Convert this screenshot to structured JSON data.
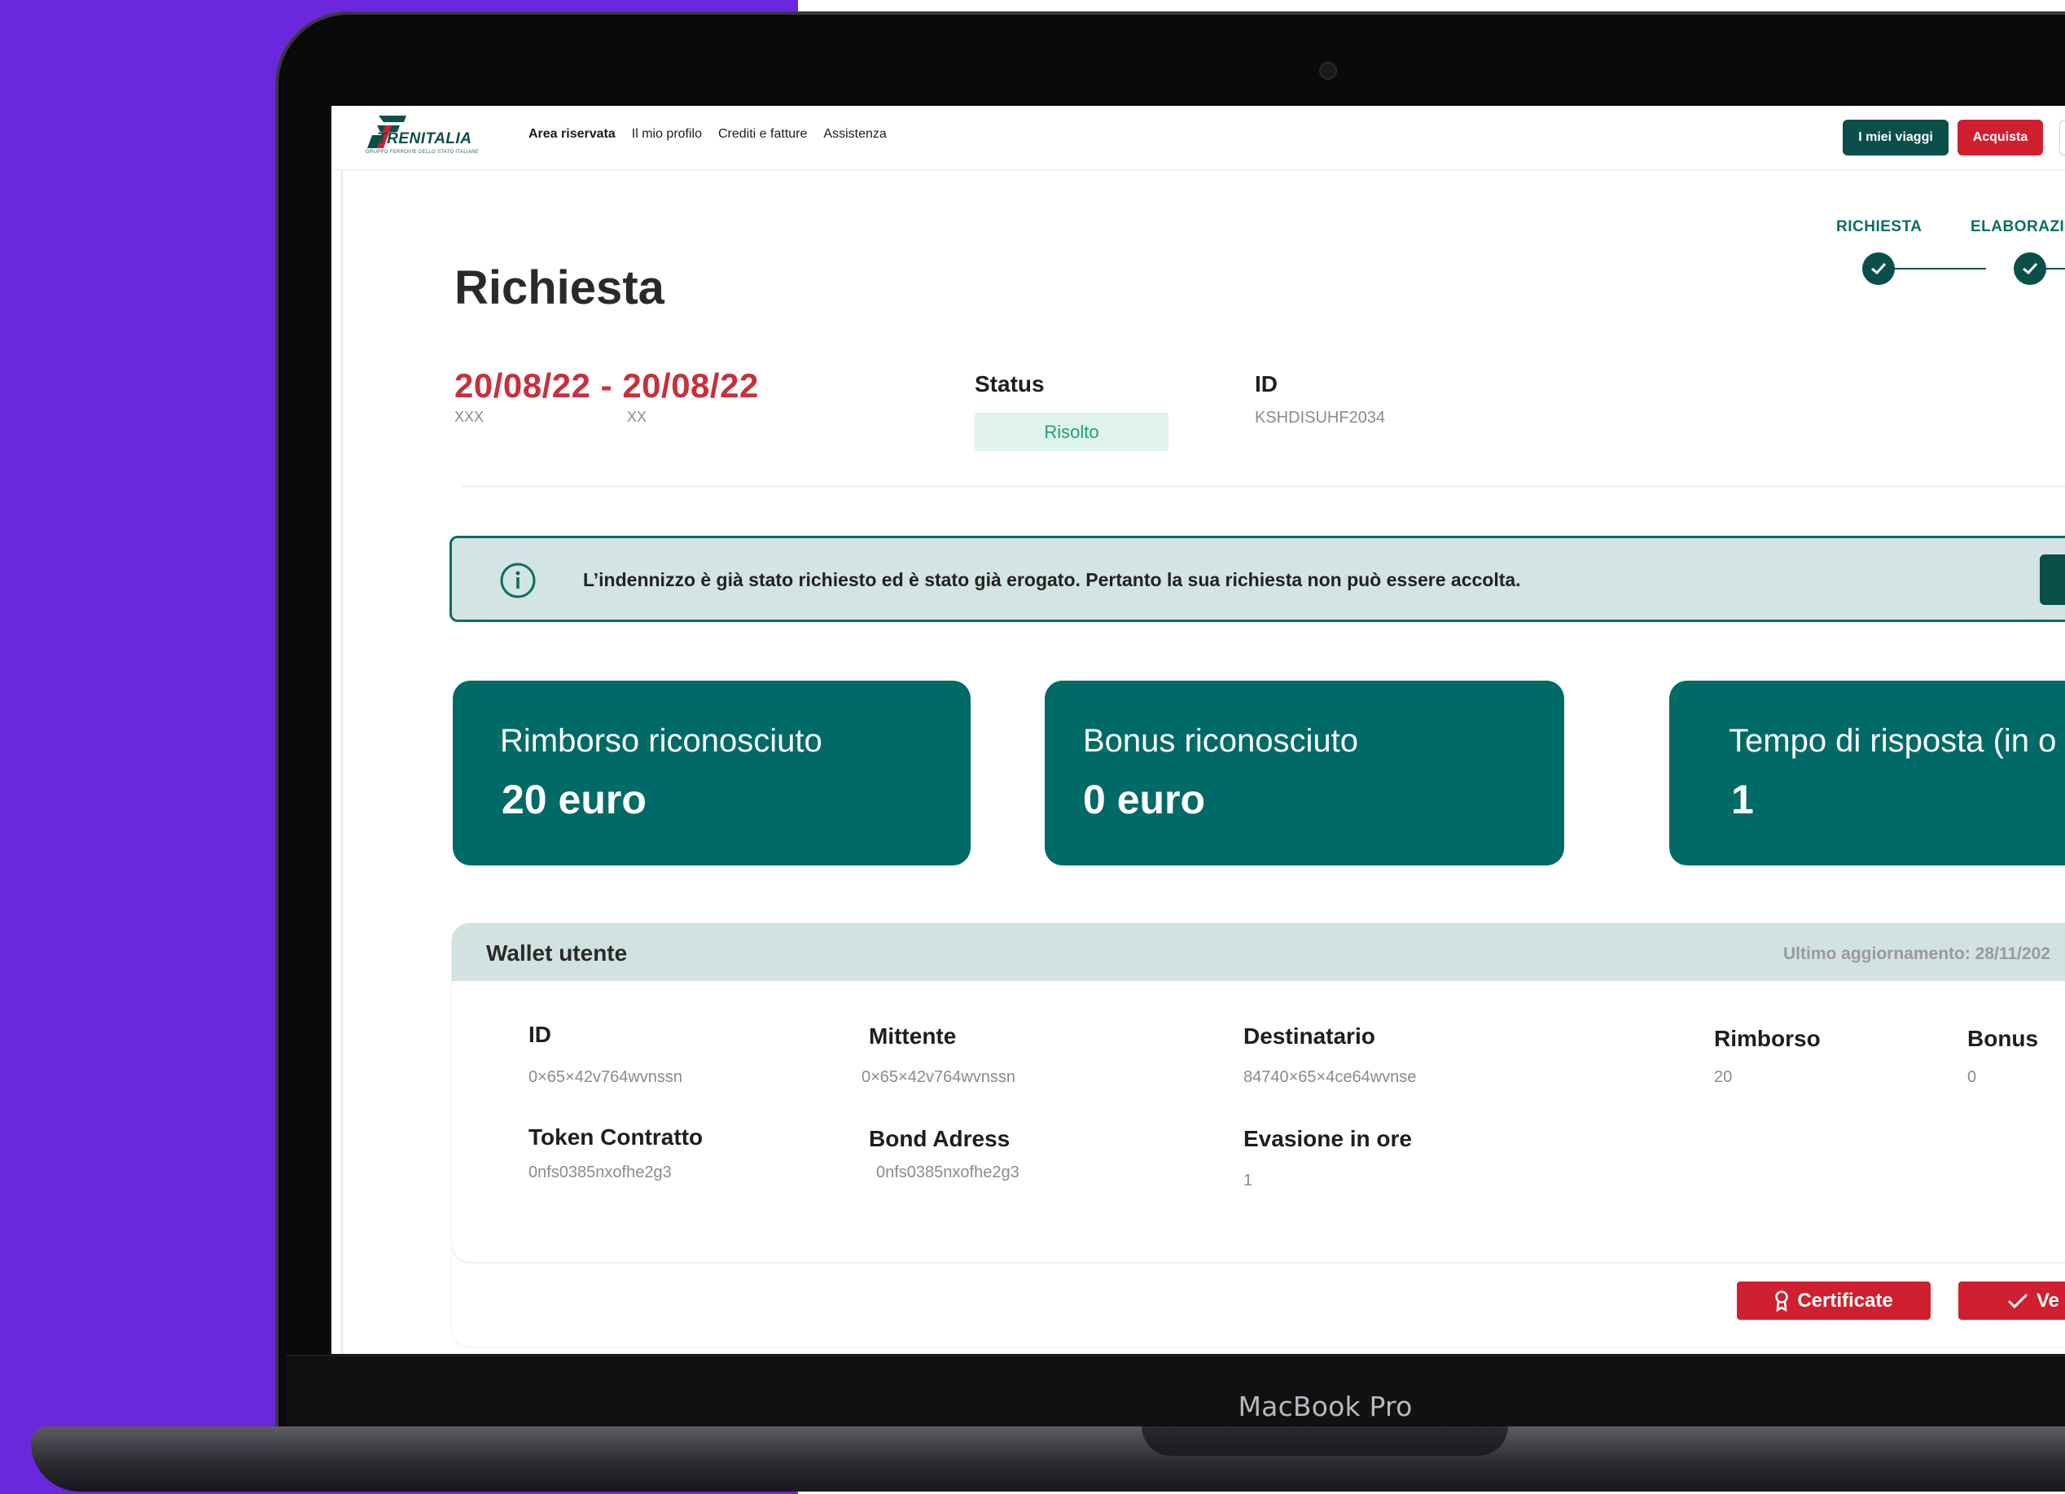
{
  "header": {
    "logo_text": "TRENITALIA",
    "logo_sub": "GRUPPO FERROVIE DELLO STATO ITALIANE",
    "nav": [
      "Area riservata",
      "Il mio profilo",
      "Crediti e fatture",
      "Assistenza"
    ],
    "btn_viaggi": "I miei viaggi",
    "btn_acquista": "Acquista"
  },
  "stepper": {
    "steps": [
      "RICHIESTA",
      "ELABORAZI"
    ]
  },
  "request": {
    "title": "Richiesta",
    "dates": "20/08/22 - 20/08/22",
    "sub_a": "XXX",
    "sub_b": "XX",
    "status_label": "Status",
    "status_value": "Risolto",
    "id_label": "ID",
    "id_value": "KSHDISUHF2034"
  },
  "banner": {
    "text": "L’indennizzo è già stato richiesto ed è stato già erogato. Pertanto la sua richiesta non può essere accolta."
  },
  "cards": [
    {
      "title": "Rimborso riconosciuto",
      "value": "20 euro"
    },
    {
      "title": "Bonus riconosciuto",
      "value": "0 euro"
    },
    {
      "title": "Tempo di risposta (in o",
      "value": "1"
    }
  ],
  "wallet": {
    "title": "Wallet utente",
    "updated": "Ultimo aggiornamento: 28/11/202",
    "fields": [
      {
        "label": "ID",
        "value": "0×65×42v764wvnssn"
      },
      {
        "label": "Mittente",
        "value": "0×65×42v764wvnssn"
      },
      {
        "label": "Destinatario",
        "value": "84740×65×4ce64wvnse"
      },
      {
        "label": "Rimborso",
        "value": "20"
      },
      {
        "label": "Bonus",
        "value": "0"
      },
      {
        "label": "Token Contratto",
        "value": "0nfs0385nxofhe2g3"
      },
      {
        "label": "Bond Adress",
        "value": "0nfs0385nxofhe2g3"
      },
      {
        "label": "Evasione in ore",
        "value": "1"
      }
    ]
  },
  "actions": {
    "certificate": "Certificate",
    "verify": "Ve"
  },
  "device": {
    "brand": "MacBook Pro"
  },
  "colors": {
    "brand_green": "#0b4f4b",
    "card_teal": "#006a66",
    "accent_red": "#d0202f",
    "background_purple": "#6b27dc"
  }
}
